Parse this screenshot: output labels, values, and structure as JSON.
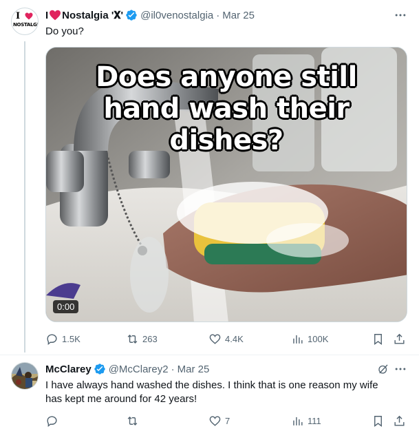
{
  "tweet1": {
    "display_name": "I❤️Nostalgia '𝐗'",
    "name_part1": "I",
    "name_part2": "Nostalgia '𝐗'",
    "handle": "@il0venostalgia",
    "separator": "·",
    "date": "Mar 25",
    "text": "Do you?",
    "avatar_letters_top": "I",
    "avatar_letters_bottom": "NOSTALGIA",
    "media": {
      "overlay_line1": "Does anyone still",
      "overlay_line2": "hand wash their dishes?",
      "timestamp": "0:00"
    },
    "actions": {
      "replies": "1.5K",
      "reposts": "263",
      "likes": "4.4K",
      "views": "100K"
    }
  },
  "tweet2": {
    "display_name": "McClarey",
    "handle": "@McClarey2",
    "separator": "·",
    "date": "Mar 25",
    "text_line1": "I have always hand washed the dishes.  I think that is one reason my wife",
    "text_line2": "has kept me around for 42 years!",
    "actions": {
      "replies": "",
      "reposts": "",
      "likes": "7",
      "views": "111"
    }
  },
  "colors": {
    "verified": "#1d9bf0",
    "secondary_text": "#536471",
    "primary_text": "#0f1419",
    "heart_red": "#e0245e",
    "thread_line": "#cfd9de"
  },
  "icons": [
    "reply-icon",
    "repost-icon",
    "like-icon",
    "views-icon",
    "bookmark-icon",
    "share-icon",
    "more-icon",
    "verified-badge-icon",
    "grok-icon"
  ]
}
